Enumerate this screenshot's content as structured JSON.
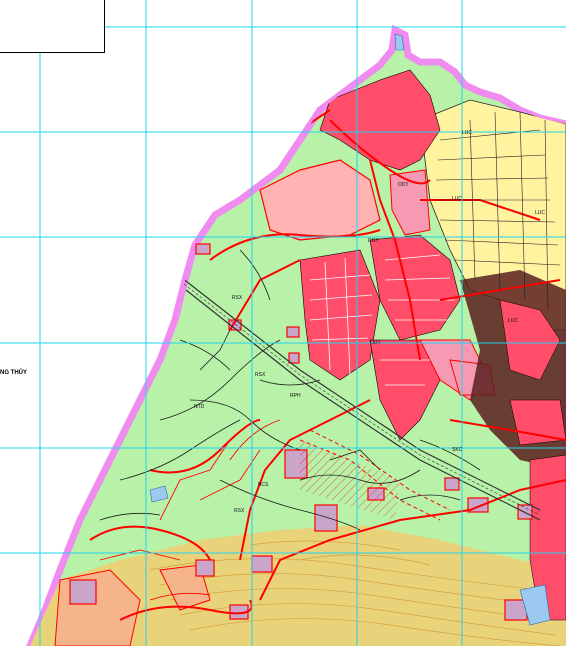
{
  "map": {
    "place_label": "NG THỦY",
    "zone_labels": [
      "LUC",
      "LUC",
      "LUC",
      "LUC",
      "ODT",
      "ODT",
      "DGT",
      "RSX",
      "RSX",
      "RSX",
      "RPH",
      "BCS",
      "NTD",
      "SKC"
    ],
    "colors": {
      "background": "#ffffff",
      "grid": "#22d3ee",
      "boundary": "#f08cf0",
      "forest": "#b7f2a8",
      "agri": "#fff3a0",
      "urban": "#ff4d6a",
      "urban_fill": "#f59ab2",
      "industrial": "#c9a6c9",
      "sand": "#e8d27a",
      "contour": "#d2a33a",
      "orange_zone": "#f6b48b",
      "road": "#ff0000",
      "stream": "#1a1a1a",
      "rail": "#333333"
    }
  }
}
